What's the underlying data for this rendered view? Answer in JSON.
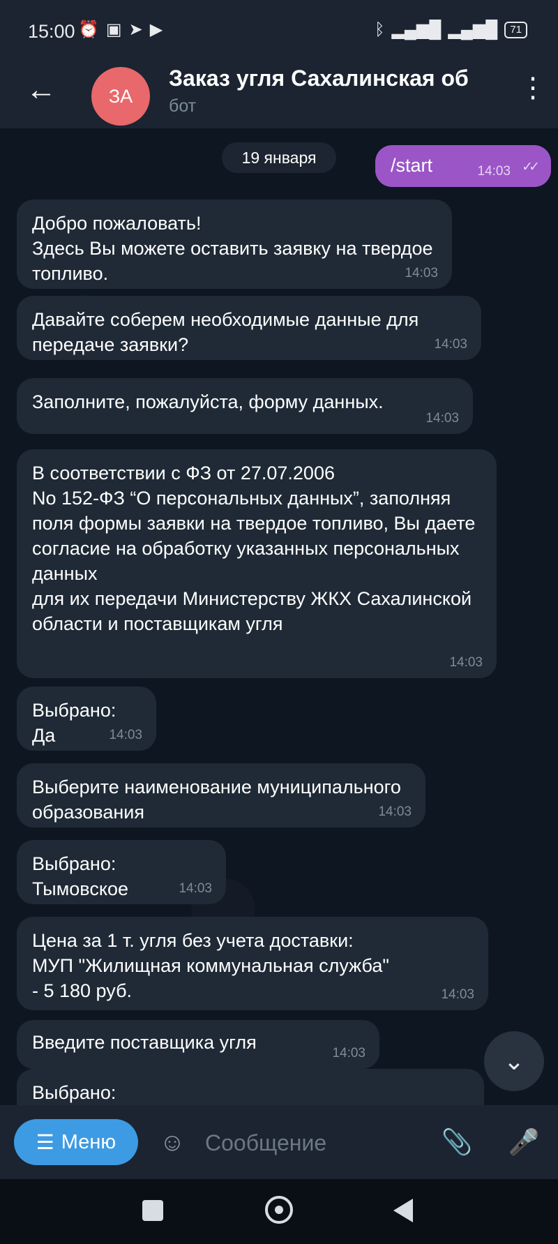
{
  "status_bar": {
    "time": "15:00",
    "left_icons": [
      "alarm-icon",
      "nfc-icon",
      "telegram-icon",
      "youtube-icon"
    ],
    "right_icons": [
      "bluetooth-icon",
      "signal-4g-icon",
      "signal-icon"
    ],
    "battery": "71"
  },
  "header": {
    "avatar_initials": "ЗА",
    "avatar_color": "#e8686b",
    "title": "Заказ угля Сахалинская об",
    "subtitle": "бот"
  },
  "chat": {
    "date_separator": "19 января",
    "outgoing": {
      "text": "/start",
      "time": "14:03"
    },
    "messages": [
      {
        "text": "Добро пожаловать!\nЗдесь Вы можете оставить заявку на твердое топливо.",
        "time": "14:03"
      },
      {
        "text": "Давайте соберем необходимые данные для передаче заявки?",
        "time": "14:03"
      },
      {
        "text": "Заполните, пожалуйста, форму данных.",
        "time": "14:03"
      },
      {
        "text": "В соответствии с ФЗ от 27.07.2006\nNo 152-ФЗ “О персональных данных”, заполняя поля формы заявки на твердое топливо, Вы даете согласие на обработку указанных персональных данных\nдля их передачи Министерству ЖКХ Сахалинской области и поставщикам угля",
        "time": "14:03"
      },
      {
        "text": "Выбрано:\nДа",
        "time": "14:03"
      },
      {
        "text": "Выберите наименование муниципального образования",
        "time": "14:03"
      },
      {
        "text": "Выбрано:\nТымовское",
        "time": "14:03"
      },
      {
        "text": "Цена за 1 т. угля без учета доставки:\nМУП \"Жилищная коммунальная служба\"\n- 5 180 руб.",
        "time": "14:03"
      },
      {
        "text": "Введите поставщика угля",
        "time": "14:03"
      },
      {
        "text": "Выбрано:",
        "time": ""
      }
    ]
  },
  "input_bar": {
    "menu_label": "Меню",
    "placeholder": "Сообщение"
  },
  "colors": {
    "background": "#0e1621",
    "incoming_bubble": "#1f2a36",
    "outgoing_bubble": "#9b55c7",
    "menu_button": "#3d9be3"
  }
}
